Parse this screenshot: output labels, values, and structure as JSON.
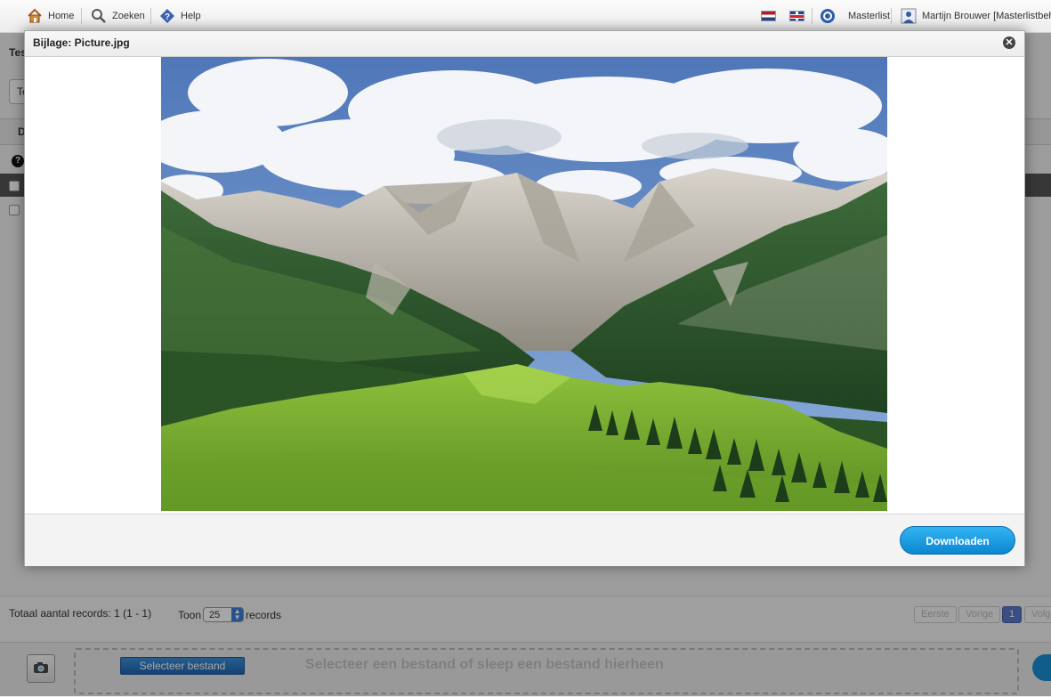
{
  "topbar": {
    "home": "Home",
    "search": "Zoeken",
    "help": "Help",
    "masterlist": "Masterlist",
    "user": "Martijn Brouwer [Masterlistbeheer"
  },
  "background": {
    "title": "Tes",
    "search_value": "Te",
    "column_header": "D",
    "total_records": "Totaal aantal records: 1 (1 - 1)",
    "show_label": "Toon",
    "show_value": "25",
    "records_label": "records",
    "pager": {
      "first": "Eerste",
      "prev": "Vorige",
      "page": "1",
      "next": "Volg"
    },
    "select_file_button": "Selecteer bestand",
    "drop_text": "Selecteer een bestand of sleep een bestand hierheen"
  },
  "dialog": {
    "title": "Bijlage: Picture.jpg",
    "download_button": "Downloaden"
  }
}
